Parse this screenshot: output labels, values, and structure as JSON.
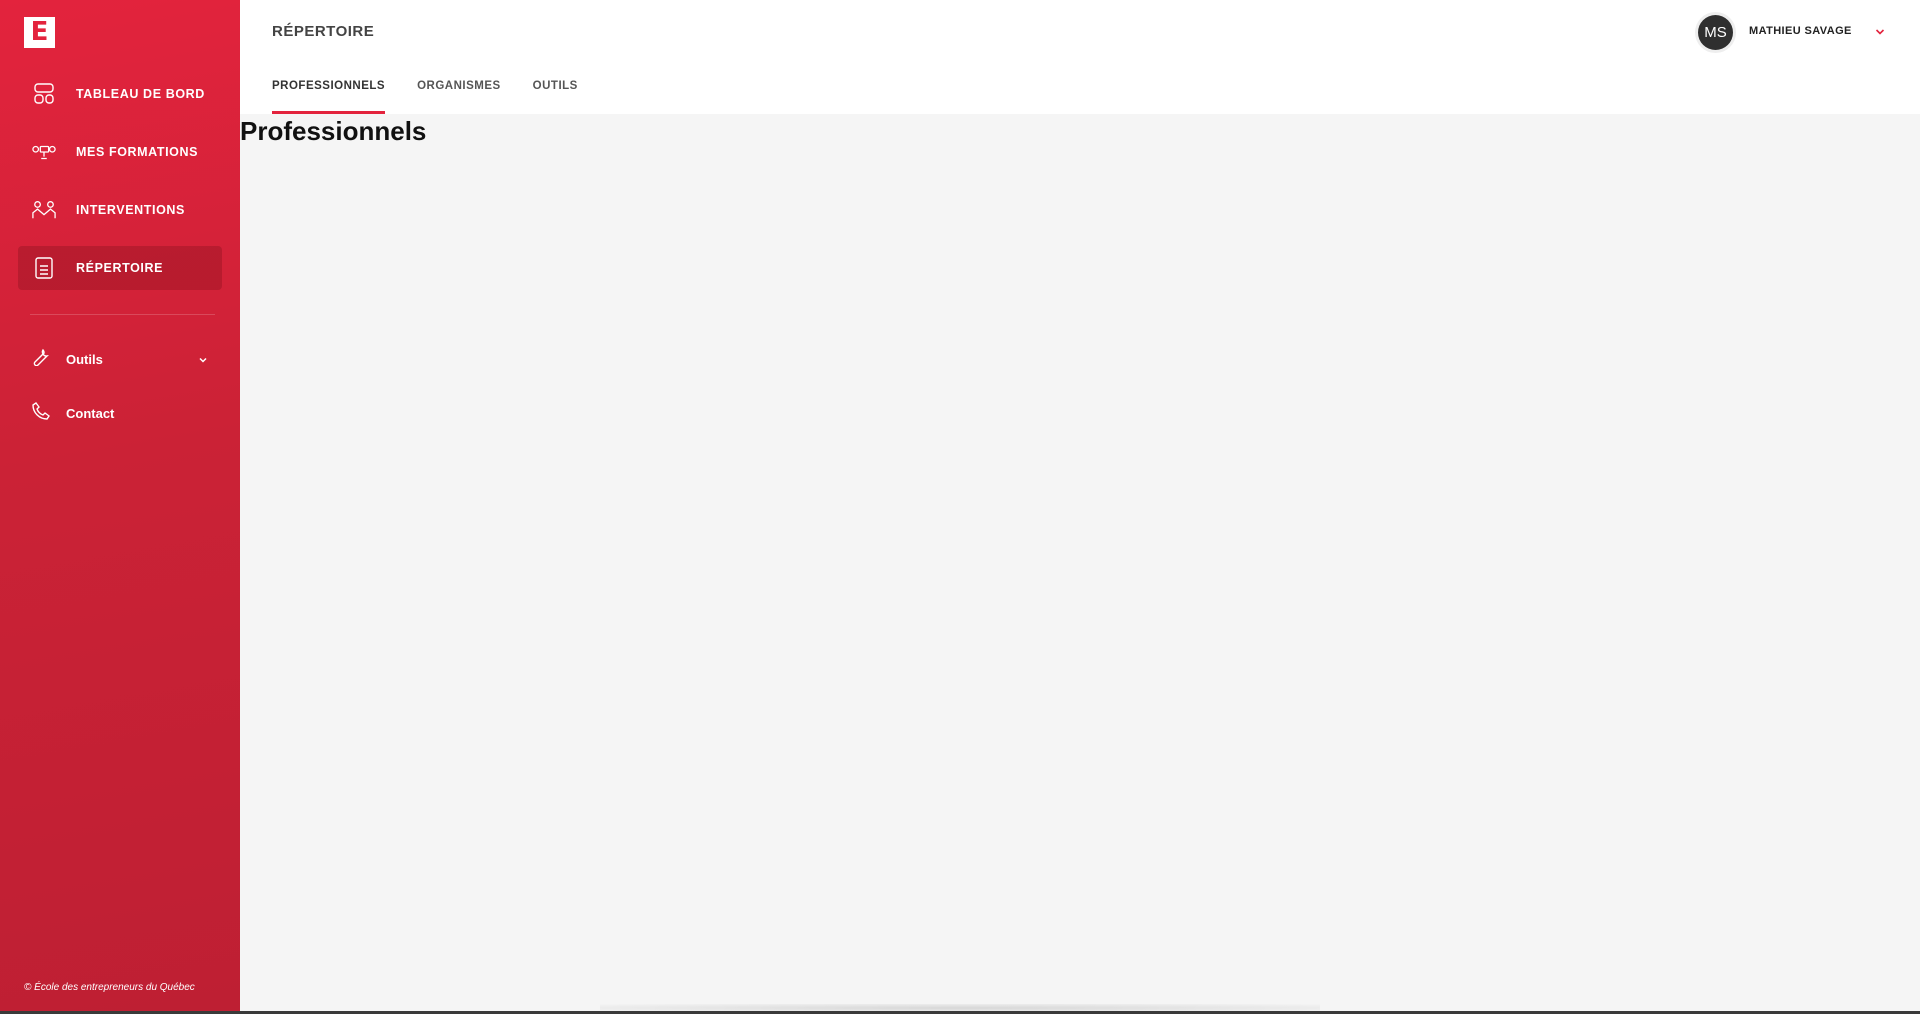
{
  "logo": {
    "letter": "E"
  },
  "sidebar": {
    "items": [
      {
        "label": "TABLEAU DE BORD",
        "icon": "dashboard-icon"
      },
      {
        "label": "MES FORMATIONS",
        "icon": "training-icon"
      },
      {
        "label": "INTERVENTIONS",
        "icon": "meeting-icon"
      },
      {
        "label": "RÉPERTOIRE",
        "icon": "directory-icon",
        "active": true
      }
    ],
    "secondary": [
      {
        "label": "Outils",
        "icon": "wrench-icon",
        "expandable": true
      },
      {
        "label": "Contact",
        "icon": "phone-icon"
      }
    ],
    "footer": "© École des entrepreneurs du Québec"
  },
  "header": {
    "title": "RÉPERTOIRE",
    "tabs": [
      {
        "label": "PROFESSIONNELS",
        "active": true
      },
      {
        "label": "ORGANISMES"
      },
      {
        "label": "OUTILS"
      }
    ],
    "user": {
      "initials": "MS",
      "name": "MATHIEU SAVAGE"
    }
  },
  "main": {
    "title": "Professionnels"
  },
  "colors": {
    "accent": "#e3233d",
    "sidebar": "#cb2236",
    "avatar": "#2f2f2f"
  }
}
